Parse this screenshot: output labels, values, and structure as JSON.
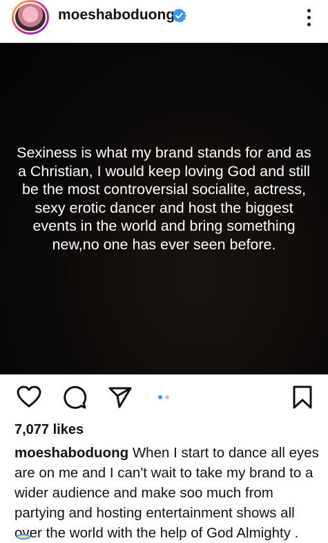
{
  "post": {
    "username": "moeshaboduong",
    "verified": true,
    "image_text": "Sexiness is what my brand stands for and as a Christian, I would keep loving God and still be the most controversial socialite, actress, sexy erotic dancer and host the biggest events in the world and bring something new,no one has ever seen before.",
    "carousel": {
      "total": 2,
      "current": 1
    },
    "likes": "7,077 likes",
    "caption_user": "moeshaboduong",
    "caption_text": " When I start to dance all eyes are on me and I can't wait to take my brand to a wider  audience and make soo much from partying and hosting entertainment shows all over the world with the help of God Almighty ."
  },
  "icons": {
    "like": "heart-icon",
    "comment": "comment-icon",
    "share": "send-icon",
    "save": "bookmark-icon",
    "more": "more-vertical-icon"
  },
  "colors": {
    "verified": "#3897f0",
    "post_background": "#0b0908",
    "carousel_active": "#3897f0"
  }
}
